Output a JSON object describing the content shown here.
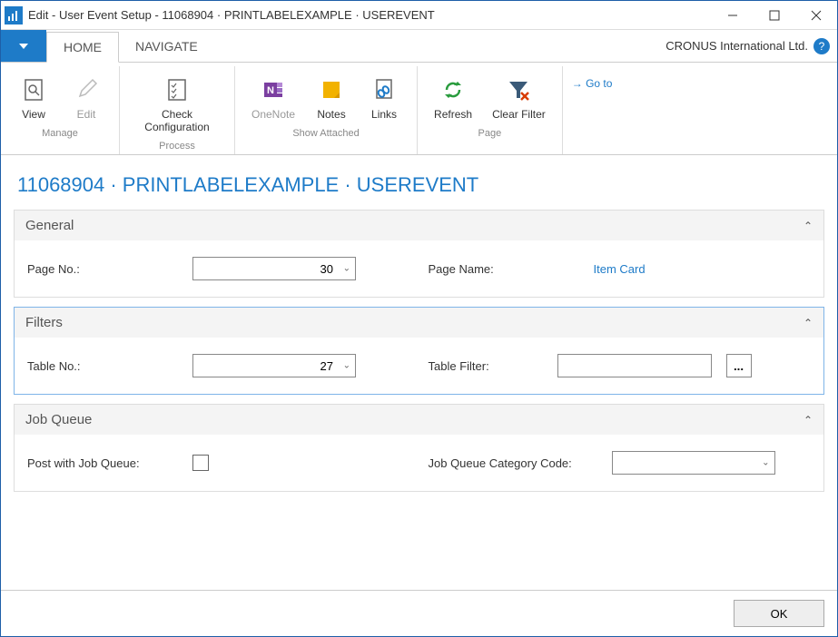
{
  "window": {
    "title": "Edit - User Event Setup - 11068904 · PRINTLABELEXAMPLE · USEREVENT"
  },
  "tabs": {
    "home": "HOME",
    "navigate": "NAVIGATE"
  },
  "company": "CRONUS International Ltd.",
  "ribbon": {
    "manage": {
      "label": "Manage",
      "view": "View",
      "edit": "Edit"
    },
    "process": {
      "label": "Process",
      "check": "Check Configuration"
    },
    "attached": {
      "label": "Show Attached",
      "onenote": "OneNote",
      "notes": "Notes",
      "links": "Links"
    },
    "page": {
      "label": "Page",
      "refresh": "Refresh",
      "clear": "Clear Filter"
    },
    "goto": "Go to"
  },
  "heading": "11068904 · PRINTLABELEXAMPLE · USEREVENT",
  "sections": {
    "general": {
      "title": "General",
      "page_no_label": "Page No.:",
      "page_no_value": "30",
      "page_name_label": "Page Name:",
      "page_name_value": "Item Card"
    },
    "filters": {
      "title": "Filters",
      "table_no_label": "Table No.:",
      "table_no_value": "27",
      "table_filter_label": "Table Filter:",
      "table_filter_value": "",
      "ellipsis": "..."
    },
    "jobqueue": {
      "title": "Job Queue",
      "post_label": "Post with Job Queue:",
      "post_checked": false,
      "category_label": "Job Queue Category Code:",
      "category_value": ""
    }
  },
  "footer": {
    "ok": "OK"
  }
}
